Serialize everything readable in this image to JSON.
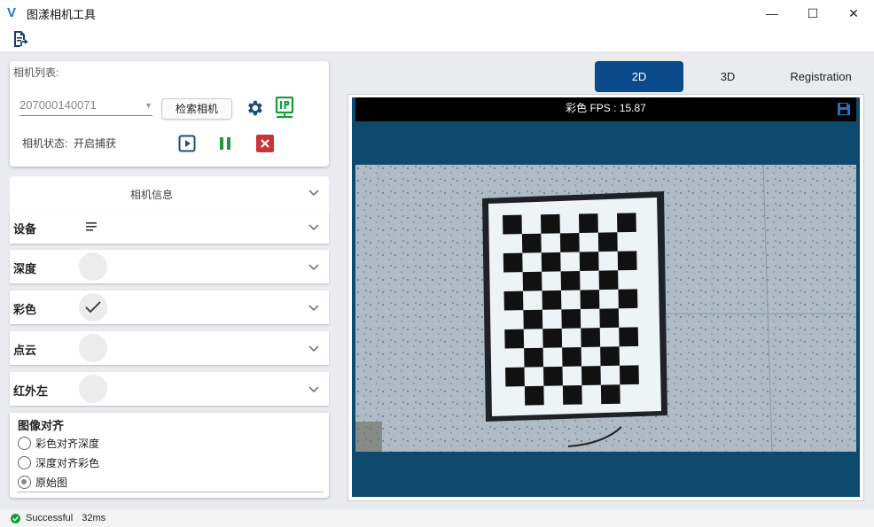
{
  "window": {
    "title": "图漾相机工具",
    "logo_text": "V",
    "minimize": "—",
    "maximize": "☐",
    "close": "✕"
  },
  "camera": {
    "list_label": "相机列表:",
    "selected_serial": "207000140071",
    "search_button": "检索相机",
    "status_label": "相机状态:",
    "status_value": "开启捕获"
  },
  "info": {
    "title": "相机信息",
    "rows": [
      {
        "label": "设备"
      },
      {
        "label": "深度"
      },
      {
        "label": "彩色"
      },
      {
        "label": "点云"
      },
      {
        "label": "红外左"
      }
    ]
  },
  "align": {
    "title": "图像对齐",
    "options": [
      "彩色对齐深度",
      "深度对齐彩色",
      "原始图"
    ],
    "selected": "原始图"
  },
  "tabs": [
    "2D",
    "3D",
    "Registration"
  ],
  "active_tab": "2D",
  "viewer": {
    "header": "彩色   FPS : 15.87"
  },
  "status": {
    "text": "Successful",
    "time": "32ms"
  },
  "colors": {
    "accent": "#0a4a8a",
    "viewer_bg": "#0e4a6e",
    "green": "#1a9a3a",
    "red": "#c9353a",
    "dark_icon": "#1c4f78"
  }
}
